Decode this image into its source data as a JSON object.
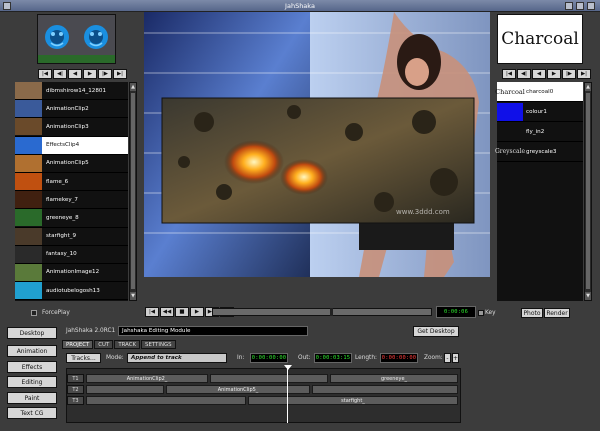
{
  "window": {
    "title": "JahShaka"
  },
  "clips": [
    {
      "label": "dibmshirow14_12801"
    },
    {
      "label": "AnimationClip2"
    },
    {
      "label": "AnimationClip3"
    },
    {
      "label": "EffectsClip4",
      "selected": true
    },
    {
      "label": "AnimationClip5"
    },
    {
      "label": "flame_6"
    },
    {
      "label": "flamekey_7"
    },
    {
      "label": "greeneye_8"
    },
    {
      "label": "starfight_9"
    },
    {
      "label": "fantasy_10"
    },
    {
      "label": "AnimationImage12"
    },
    {
      "label": "audiotubelogosh13"
    }
  ],
  "effects": {
    "preview_text": "Charcoal",
    "items": [
      {
        "thumb": "Charcoal",
        "label": "charcoal0",
        "selected": true
      },
      {
        "thumb": "",
        "label": "colour1"
      },
      {
        "thumb": "",
        "label": "fly_in2"
      },
      {
        "thumb": "Greyscale",
        "label": "greyscale3"
      }
    ]
  },
  "transport": {
    "force_play": "ForcePlay",
    "timecode": "0:00:06",
    "key_label": "Key",
    "photo": "Photo",
    "render": "Render"
  },
  "side_buttons": {
    "desktop": "Desktop",
    "animation": "Animation",
    "effects": "Effects",
    "editing": "Editing",
    "paint": "Paint",
    "textcg": "Text CG"
  },
  "module": {
    "version": "JahShaka 2.0RC1",
    "name": "Jahshaka Editing Module",
    "get_desktop": "Get Desktop"
  },
  "tabs": [
    "PROJECT",
    "CUT",
    "TRACK",
    "SETTINGS"
  ],
  "edit_bar": {
    "tracks_btn": "Tracks...",
    "mode_label": "Mode:",
    "mode_value": "Append to track",
    "in_label": "In:",
    "in_tc": "0:00:00:00",
    "out_label": "Out:",
    "out_tc": "0:00:03:15",
    "length_label": "Length:",
    "length_tc": "0:00:00:00",
    "zoom_label": "Zoom:",
    "zoom_minus": "-",
    "zoom_plus": "+"
  },
  "timeline": {
    "tracks": [
      {
        "label": "T1",
        "segs": [
          "AnimationClip2_",
          "",
          "greeneye_"
        ]
      },
      {
        "label": "T2",
        "segs": [
          "",
          "AnimationClip5_",
          ""
        ]
      },
      {
        "label": "T3",
        "segs": [
          "",
          "starfight_"
        ]
      }
    ]
  },
  "watermark": "www.3ddd.com",
  "colors": {
    "accent_selected": "#ffffff",
    "timecode_green": "#2ee82e",
    "timecode_red": "#ff3a3a",
    "colour_swatch": "#1010e8"
  }
}
